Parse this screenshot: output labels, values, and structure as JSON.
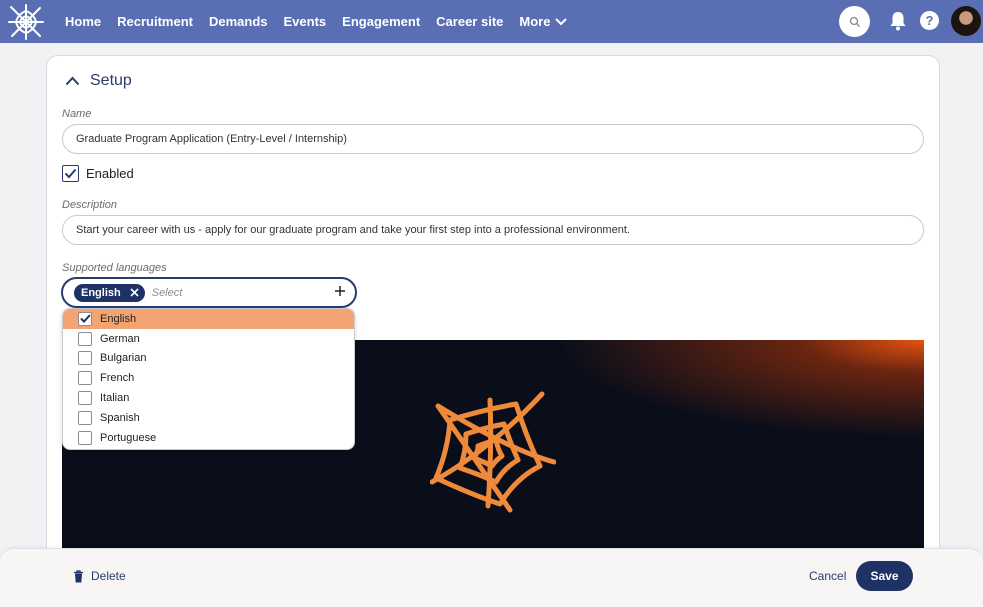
{
  "nav": {
    "links": [
      "Home",
      "Recruitment",
      "Demands",
      "Events",
      "Engagement",
      "Career site"
    ],
    "more_label": "More",
    "help_label": "?"
  },
  "setup": {
    "title": "Setup",
    "name_label": "Name",
    "name_value": "Graduate Program Application (Entry-Level / Internship)",
    "enabled_label": "Enabled",
    "enabled": true,
    "description_label": "Description",
    "description_value": "Start your career with us - apply for our graduate program and take your first step into a professional environment.",
    "languages_label": "Supported languages",
    "selected_chip": "English",
    "select_placeholder": "Select",
    "options": [
      {
        "label": "English",
        "checked": true
      },
      {
        "label": "German",
        "checked": false
      },
      {
        "label": "Bulgarian",
        "checked": false
      },
      {
        "label": "French",
        "checked": false
      },
      {
        "label": "Italian",
        "checked": false
      },
      {
        "label": "Spanish",
        "checked": false
      },
      {
        "label": "Portuguese",
        "checked": false
      }
    ]
  },
  "footer": {
    "delete_label": "Delete",
    "cancel_label": "Cancel",
    "save_label": "Save"
  },
  "colors": {
    "nav_bg": "#5a6fb3",
    "primary": "#1e3266",
    "highlight": "#f3a473",
    "brand_orange": "#ee8a3a"
  }
}
